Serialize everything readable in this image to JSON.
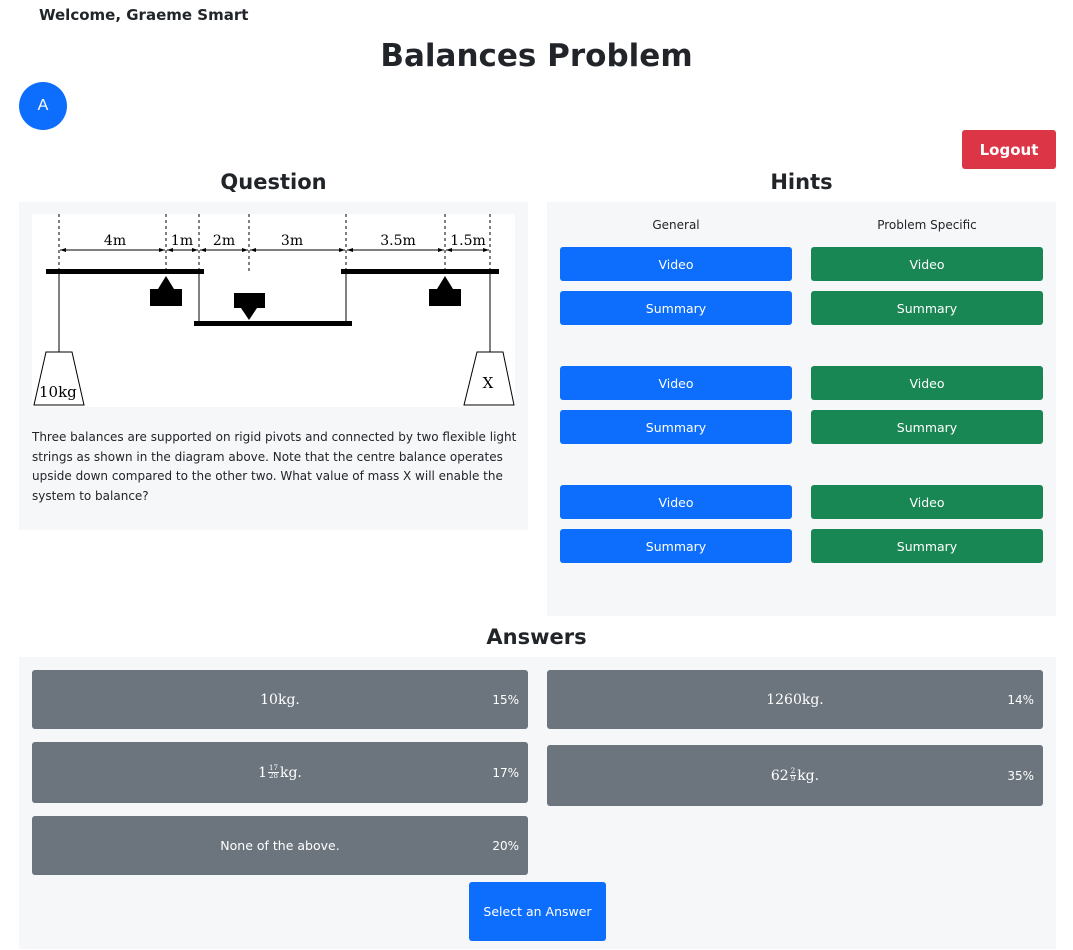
{
  "header": {
    "welcome": "Welcome, Graeme Smart",
    "title": "Balances Problem",
    "avatar_letter": "A",
    "logout_label": "Logout"
  },
  "question": {
    "heading": "Question",
    "diagram": {
      "distances": [
        "4m",
        "1m",
        "2m",
        "3m",
        "3.5m",
        "1.5m"
      ],
      "left_mass": "10kg",
      "right_mass": "X"
    },
    "text": "Three balances are supported on rigid pivots and connected by two flexible light strings as shown in the diagram above. Note that the centre balance operates upside down compared to the other two. What value of mass X will enable the system to balance?"
  },
  "hints": {
    "heading": "Hints",
    "general_label": "General",
    "specific_label": "Problem Specific",
    "groups": [
      {
        "general": {
          "video": "Video",
          "summary": "Summary"
        },
        "specific": {
          "video": "Video",
          "summary": "Summary"
        }
      },
      {
        "general": {
          "video": "Video",
          "summary": "Summary"
        },
        "specific": {
          "video": "Video",
          "summary": "Summary"
        }
      },
      {
        "general": {
          "video": "Video",
          "summary": "Summary"
        },
        "specific": {
          "video": "Video",
          "summary": "Summary"
        }
      }
    ]
  },
  "answers": {
    "heading": "Answers",
    "options": [
      {
        "label": "10kg.",
        "pct": "15%"
      },
      {
        "label": "1260kg.",
        "pct": "14%"
      },
      {
        "whole": "1",
        "num": "17",
        "den": "28",
        "unit": "kg.",
        "pct": "17%"
      },
      {
        "whole": "62",
        "num": "2",
        "den": "9",
        "unit": "kg.",
        "pct": "35%"
      },
      {
        "label": "None of the above.",
        "pct": "20%"
      }
    ],
    "select_label": "Select an Answer"
  },
  "colors": {
    "primary": "#0d6efd",
    "success": "#198754",
    "danger": "#dc3545",
    "secondary": "#6c757d",
    "panel": "#f6f7f9"
  }
}
